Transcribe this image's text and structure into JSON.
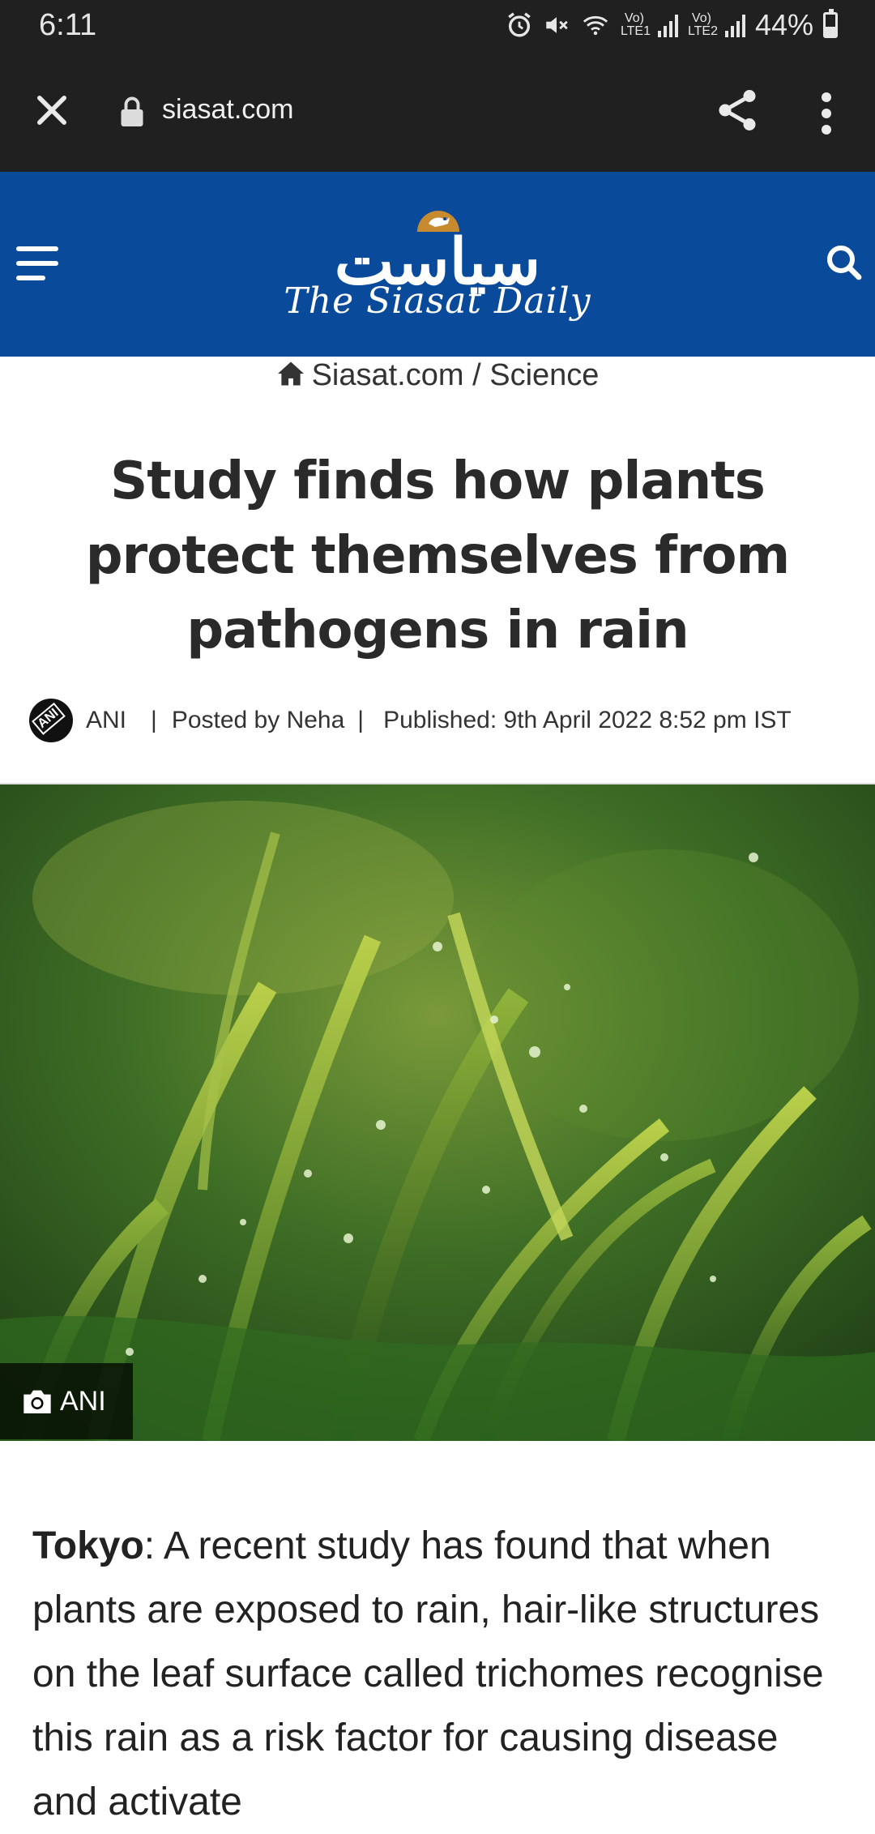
{
  "status_bar": {
    "time": "6:11",
    "sim1": "Vo) LTE1",
    "sim2": "Vo) LTE2",
    "battery": "44%"
  },
  "browser": {
    "url": "siasat.com",
    "icons": [
      "close-icon",
      "lock-icon",
      "share-icon",
      "more-vert-icon"
    ]
  },
  "site_header": {
    "logo_urdu": "سیاست",
    "logo_english": "The Siasat Daily",
    "background": "#0a4a9a",
    "icons": [
      "menu-icon",
      "search-icon"
    ]
  },
  "breadcrumb": {
    "home": "Siasat.com",
    "separator": "/",
    "section": "Science"
  },
  "article": {
    "title": "Study finds how plants protect themselves from pathogens in rain",
    "source": "ANI",
    "divider": "|",
    "posted_by": "Posted by Neha",
    "published": "Published: 9th April 2022 8:52 pm IST",
    "image_credit": "ANI",
    "dateline": "Tokyo",
    "lead": ": A recent study has found that when plants are exposed to rain, hair-like structures on the leaf surface called trichomes recognise this rain as a risk factor for causing disease and activate"
  }
}
